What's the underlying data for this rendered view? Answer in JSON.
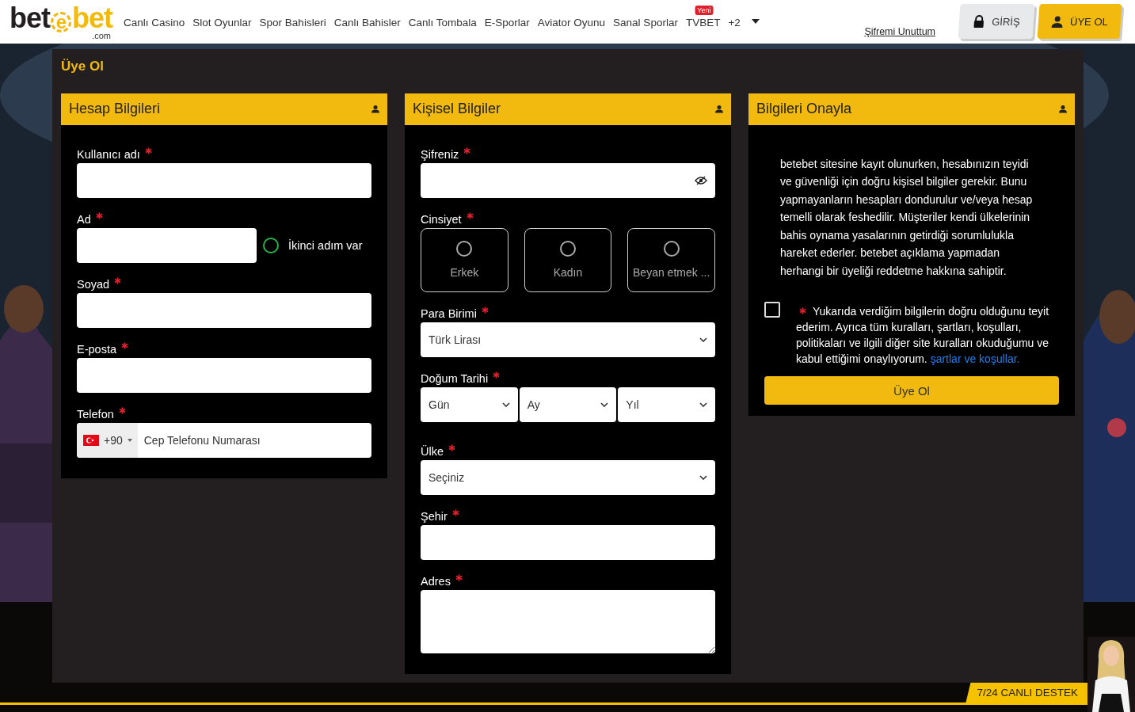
{
  "logo": {
    "left": "bet",
    "mark": "e",
    "right": "bet",
    "domain": ".com"
  },
  "nav": [
    {
      "label": "Canlı Casino"
    },
    {
      "label": "Slot Oyunlar"
    },
    {
      "label": "Spor Bahisleri"
    },
    {
      "label": "Canlı Bahisler"
    },
    {
      "label": "Canlı Tombala"
    },
    {
      "label": "E-Sporlar"
    },
    {
      "label": "Aviator Oyunu"
    },
    {
      "label": "Sanal Sporlar"
    },
    {
      "label": "TVBET",
      "badge": "Yeni"
    },
    {
      "label": "+2"
    }
  ],
  "forgot_link": "Şifremi Unuttum",
  "login_button": "GİRİŞ",
  "signup_button": "ÜYE OL",
  "page_title": "Üye Ol",
  "sections": [
    {
      "title": "Hesap Bilgileri",
      "fields": [
        {
          "kind": "text",
          "label": "Kullanıcı adı",
          "required": true
        },
        {
          "kind": "text-radio",
          "label": "Ad",
          "required": true,
          "option": "İkinci adım var",
          "checked": false
        },
        {
          "kind": "text",
          "label": "Soyad",
          "required": true
        },
        {
          "kind": "text",
          "label": "E-posta",
          "required": true
        },
        {
          "kind": "phone",
          "label": "Telefon",
          "required": true,
          "code": "+90",
          "placeholder": "Cep Telefonu Numarası"
        }
      ]
    },
    {
      "title": "Kişisel Bilgiler",
      "fields": [
        {
          "kind": "password",
          "label": "Şifreniz",
          "required": true
        },
        {
          "kind": "options",
          "label": "Cinsiyet",
          "required": true,
          "options": [
            {
              "label": "Erkek",
              "selected": false
            },
            {
              "label": "Kadın",
              "selected": false
            },
            {
              "label": "Beyan etmek ...",
              "selected": false
            }
          ]
        },
        {
          "kind": "select",
          "label": "Para Birimi",
          "required": true,
          "values": [
            "Türk Lirası"
          ]
        },
        {
          "kind": "select",
          "label": "Doğum Tarihi",
          "required": true,
          "values": [
            "Gün",
            "Ay",
            "Yıl"
          ]
        },
        {
          "kind": "select",
          "label": "Ülke",
          "required": true,
          "values": [
            "Seçiniz"
          ]
        },
        {
          "kind": "text",
          "label": "Şehir",
          "required": true
        },
        {
          "kind": "textarea",
          "label": "Adres",
          "required": true
        }
      ]
    },
    {
      "title": "Bilgileri Onayla",
      "notice": "betebet sitesine kayıt olunurken, hesabınızın teyidi ve güvenliği için doğru kişisel bilgiler gerekir. Bunu yapmayanların hesapları dondurulur ve/veya hesap temelli olarak feshedilir. Müşteriler kendi ülkelerinin bahis oynama yasalarının getirdiği sorumlulukla hareket ederler. betebet açıklama yapmadan herhangi bir üyeliği reddetme hakkına sahiptir.",
      "consent": {
        "checked": false,
        "required": true,
        "text": "Yukarıda verdiğim bilgilerin doğru olduğunu teyit ederim. Ayrıca tüm kuralları, şartları, koşulları, politikaları ve ilgili diğer site kuralları okuduğumu ve kabul ettiğimi onaylıyorum.",
        "link": "şartlar ve koşullar."
      },
      "submit": "Üye Ol"
    }
  ],
  "support": "7/24 CANLI DESTEK"
}
